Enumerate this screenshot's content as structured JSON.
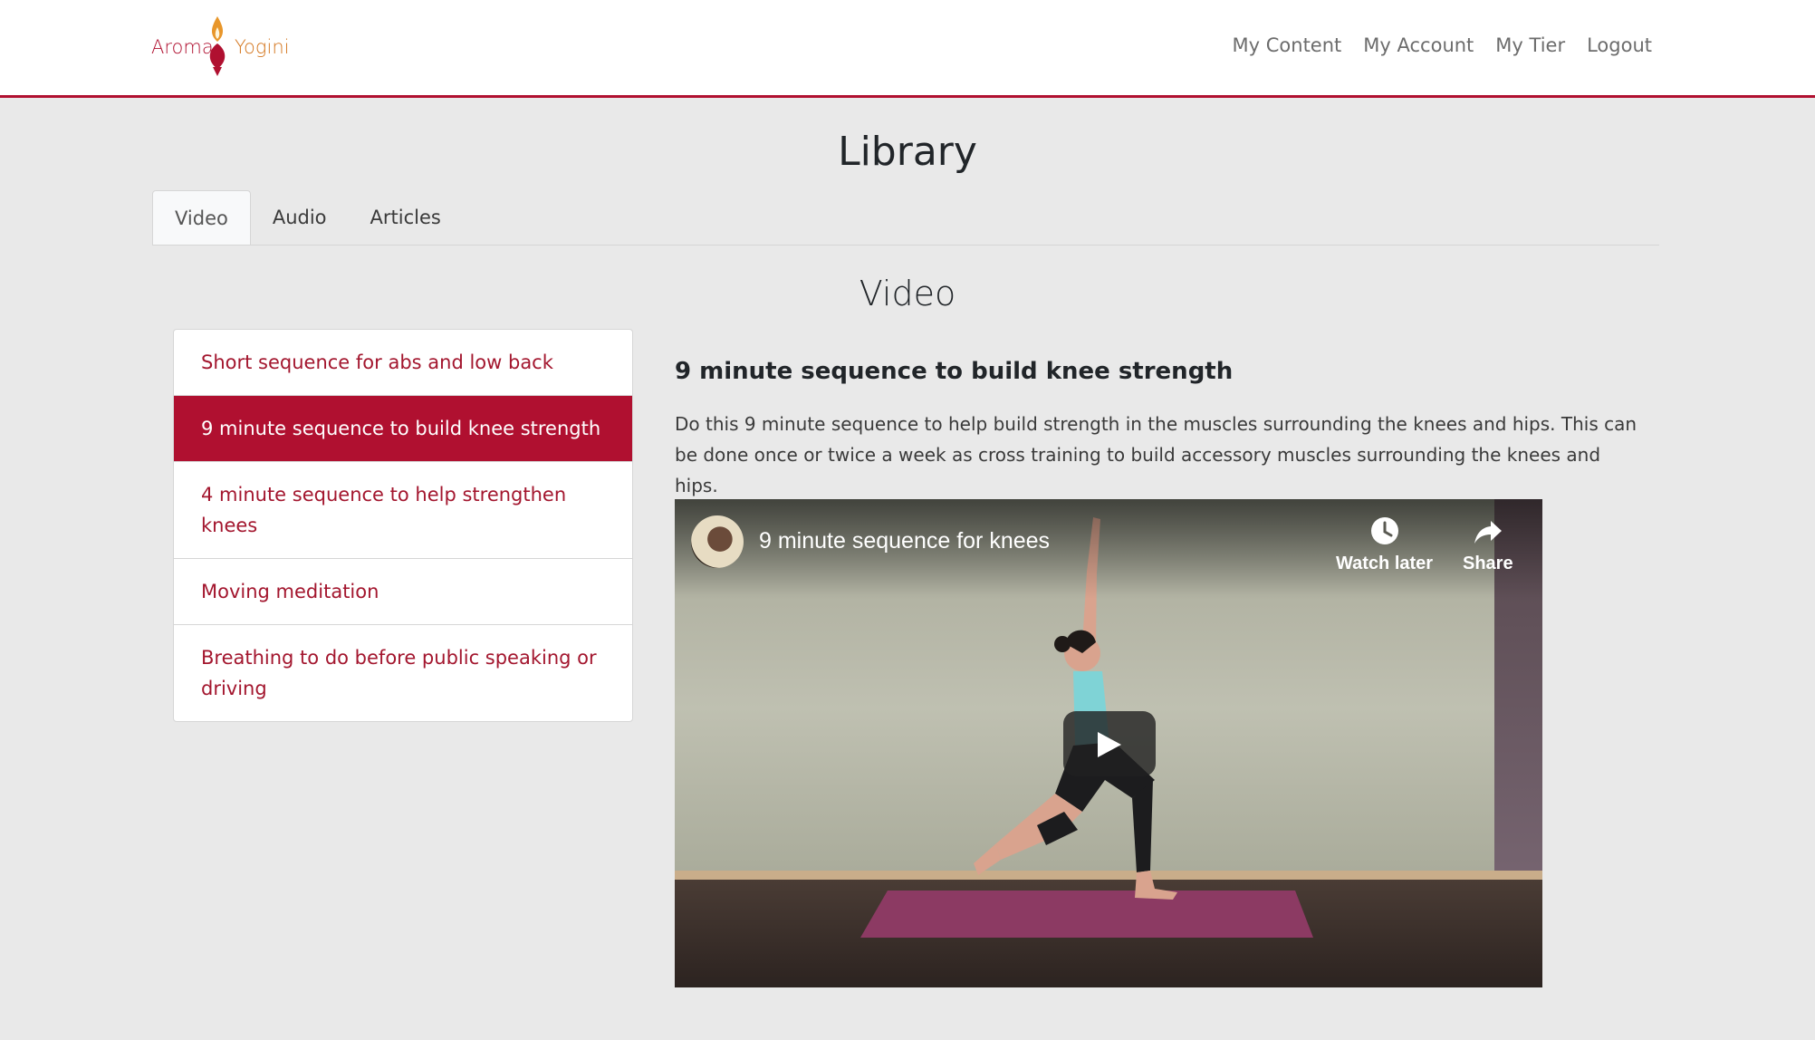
{
  "header": {
    "logo_left": "Aroma",
    "logo_right": "Yogini",
    "nav": [
      "My Content",
      "My Account",
      "My Tier",
      "Logout"
    ]
  },
  "page": {
    "title": "Library",
    "tabs": [
      "Video",
      "Audio",
      "Articles"
    ],
    "active_tab": "Video",
    "section_title": "Video"
  },
  "video_list": {
    "items": [
      "Short sequence for abs and low back",
      "9 minute sequence to build knee strength",
      "4 minute sequence to help strengthen knees",
      "Moving meditation",
      "Breathing to do before public speaking or driving"
    ],
    "selected_index": 1
  },
  "selected_video": {
    "title": "9 minute sequence to build knee strength",
    "description": "Do this 9 minute sequence to help build strength in the muscles surrounding the knees and hips. This can be done once or twice a week as cross training to build accessory muscles surrounding the knees and hips.",
    "player_title": "9 minute sequence for knees",
    "watch_later_label": "Watch later",
    "share_label": "Share"
  },
  "colors": {
    "brand": "#b01030",
    "accent": "#d4761e",
    "background": "#e9e9e9"
  },
  "icons": {
    "watch_later": "clock-icon",
    "share": "share-arrow-icon",
    "play": "play-icon"
  }
}
